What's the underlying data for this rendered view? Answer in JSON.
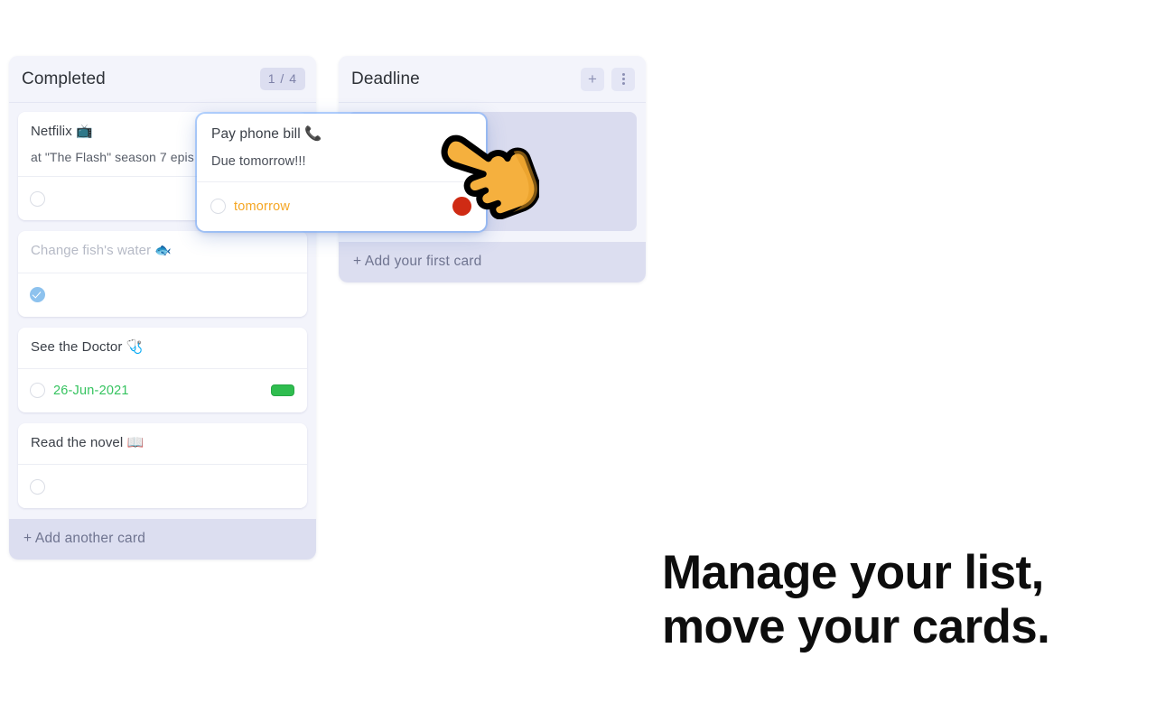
{
  "board": {
    "columns": [
      {
        "id": "completed",
        "title": "Completed",
        "count_badge": "1 / 4",
        "add_label": "+ Add another card",
        "cards": [
          {
            "title": "Netfilix 📺",
            "description": "at \"The Flash\" season 7 epis",
            "checked": false,
            "date": "",
            "label": "none"
          },
          {
            "title": "Change fish's water 🐟",
            "description": "",
            "checked": true,
            "date": "",
            "label": "none"
          },
          {
            "title": "See the Doctor 🩺",
            "description": "",
            "checked": false,
            "date": "26-Jun-2021",
            "label": "green"
          },
          {
            "title": "Read the novel 📖",
            "description": "",
            "checked": false,
            "date": "",
            "label": "none"
          }
        ]
      },
      {
        "id": "deadline",
        "title": "Deadline",
        "add_button_label": "+",
        "menu_button_label": "⋮",
        "add_label": "+ Add your first card",
        "cards": []
      }
    ]
  },
  "drag_card": {
    "title": "Pay phone bill 📞",
    "description": "Due tomorrow!!!",
    "checked": false,
    "date": "tomorrow",
    "label": "red"
  },
  "cursor": {
    "icon": "pointing-hand-cursor"
  },
  "tagline": {
    "line1": "Manage your list,",
    "line2": "move your cards."
  },
  "colors": {
    "column_bg": "#f3f4fb",
    "add_card_bg": "#dcdef0",
    "placeholder_bg": "#dadcef",
    "badge_bg": "#dcdef0",
    "green_label": "#2fbd4f",
    "red_label": "#cf2b14",
    "orange_text": "#f5a623",
    "green_text": "#35c35f",
    "drag_outline": "#78afff"
  }
}
